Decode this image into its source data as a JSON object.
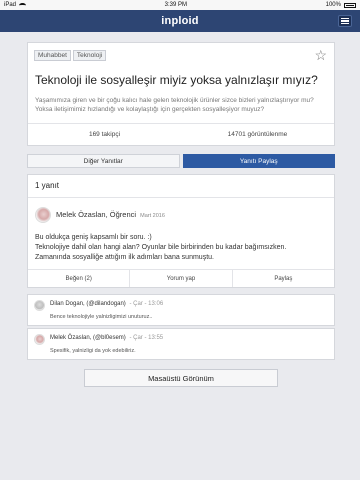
{
  "status_bar": {
    "carrier": "iPad",
    "time": "3:39 PM",
    "battery": "100%"
  },
  "header": {
    "logo": "inploid"
  },
  "question": {
    "tags": [
      "Muhabbet",
      "Teknoloji"
    ],
    "title": "Teknoloji ile sosyalleşir miyiz yoksa yalnızlaşır mıyız?",
    "description": "Yaşamımıza giren ve bir çoğu kalıcı hale gelen teknolojik ürünler sizce bizleri yalnızlaştırıyor mu? Yoksa iletişimimiz hızlandığı ve kolaylaştığı için gerçekten sosyalleşiyor muyuz?",
    "followers": "169 takipçi",
    "views": "14701 görüntülenme"
  },
  "tabs": {
    "other_answers": "Diğer Yanıtlar",
    "share_answer": "Yanıtı Paylaş"
  },
  "answer": {
    "count_label": "1 yanıt",
    "author": "Melek Özaslan, Öğrenci",
    "date": "Mart 2016",
    "lines": [
      "Bu oldukça geniş kapsamlı bir soru. :)",
      "Teknolojiye dahil olan hangi alan? Oyunlar bile birbirinden bu kadar bağımsızken.",
      "Zamanında sosyalliğe attığım ilk adımları bana sunmuştu."
    ],
    "actions": {
      "like": "Beğen (2)",
      "comment": "Yorum yap",
      "share": "Paylaş"
    }
  },
  "comments": [
    {
      "author": "Dilan Dogan, (@dilandogan)",
      "date": "- Çar - 13:06",
      "text": "Bence teknolojiyle yalnizligimizi unuturuz.."
    },
    {
      "author": "Melek Özaslan, (@bl0esem)",
      "date": "- Çar - 13:55",
      "text": "Spesifik, yalnizligi da yok edebiliriz."
    }
  ],
  "footer": {
    "desktop_view": "Masaüstü Görünüm"
  }
}
